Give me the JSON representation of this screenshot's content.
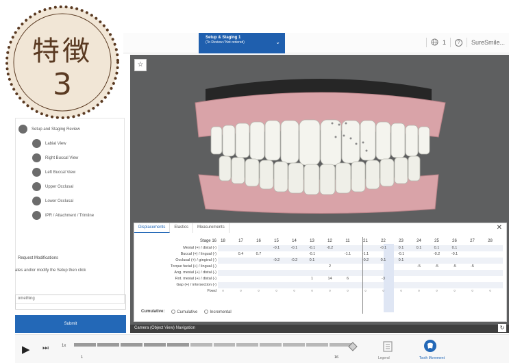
{
  "badge": {
    "title": "特徴",
    "number": "3"
  },
  "topbar": {
    "active_tab_title": "Setup & Staging 1",
    "active_tab_sub": "(To Review / Not ordered)",
    "chevron": "⌄",
    "globe_count": "1",
    "help": "?",
    "brand": "SureSmile..."
  },
  "left": {
    "review_title": "Setup and Staging Review",
    "review_items": [
      "Labial View",
      "Right Buccal View",
      "Left Buccal View",
      "Upper Occlusal",
      "Lower Occlusal",
      "IPR / Attachment / Trimline"
    ],
    "request_title": "Request Modifications",
    "request_desc": "ates and/or modify the Setup then click",
    "request_placeholder": "omething",
    "submit_label": "Submit"
  },
  "viewer": {
    "star": "☆"
  },
  "table": {
    "tabs": [
      "Displacements",
      "Elastics",
      "Measurements"
    ],
    "close": "✕",
    "stage_label": "Stage 16",
    "teeth": [
      "18",
      "17",
      "16",
      "15",
      "14",
      "13",
      "12",
      "11",
      "21",
      "22",
      "23",
      "24",
      "25",
      "26",
      "27",
      "28"
    ],
    "rows": [
      {
        "label": "Mesial (+) / distal (-)",
        "values": [
          "",
          "",
          "",
          "-0.1",
          "-0.1",
          "-0.1",
          "-0.2",
          "",
          "",
          "-0.1",
          "0.1",
          "0.1",
          "0.1",
          "0.1",
          "",
          ""
        ]
      },
      {
        "label": "Buccal (+) / lingual (-)",
        "values": [
          "",
          "0.4",
          "0.7",
          "",
          "",
          "-0.1",
          "",
          "-1.1",
          "-1.1",
          "",
          "-0.1",
          "",
          "-0.2",
          "-0.1",
          "",
          ""
        ]
      },
      {
        "label": "Occlusal (+) / gingival (-)",
        "values": [
          "",
          "",
          "",
          "-0.2",
          "-0.2",
          "0.1",
          "",
          "",
          "-0.2",
          "0.1",
          "0.1",
          "",
          "",
          "",
          "",
          ""
        ]
      },
      {
        "label": "Torque facial (+) / lingual (-)",
        "values": [
          "",
          "",
          "",
          "",
          "",
          "",
          "2",
          "",
          "",
          "",
          "",
          "-5",
          "-5",
          "-5",
          "-5",
          ""
        ]
      },
      {
        "label": "Ang. mesial (+) / distal (-)",
        "values": [
          "",
          "",
          "",
          "",
          "",
          "",
          "",
          "",
          "",
          "",
          "",
          "",
          "",
          "",
          "",
          ""
        ]
      },
      {
        "label": "Rot. mesial (+) / distal (-)",
        "values": [
          "",
          "",
          "",
          "",
          "",
          "1",
          "14",
          "6",
          "",
          "-3",
          "",
          "",
          "",
          "",
          "",
          ""
        ]
      },
      {
        "label": "Gap (+) / intersection (-)",
        "values": [
          "",
          "",
          "",
          "",
          "",
          "",
          "",
          "",
          "",
          "",
          "",
          "",
          "",
          "",
          "",
          ""
        ]
      },
      {
        "label": "Fixed",
        "values": [
          "○",
          "○",
          "○",
          "○",
          "○",
          "○",
          "○",
          "○",
          "○",
          "○",
          "○",
          "○",
          "○",
          "○",
          "○",
          "○"
        ]
      }
    ],
    "cumulative_label": "Cumulative:",
    "opt_cumulative": "Cumulative",
    "opt_incremental": "Incremental"
  },
  "navcap": {
    "label": "Camera (Object View) Navigation",
    "refresh": "↻"
  },
  "controls": {
    "play": "▶",
    "step": "⏭",
    "speed": "1x",
    "ticks": [
      "1",
      "",
      "",
      "",
      "16"
    ],
    "legend_label": "Legend",
    "tooth_label": "Tooth Movement"
  },
  "colors": {
    "accent": "#1f5fae",
    "badge_bg": "#f1e6d6",
    "badge_text": "#5a3a22",
    "gum": "#d9a3a8"
  }
}
